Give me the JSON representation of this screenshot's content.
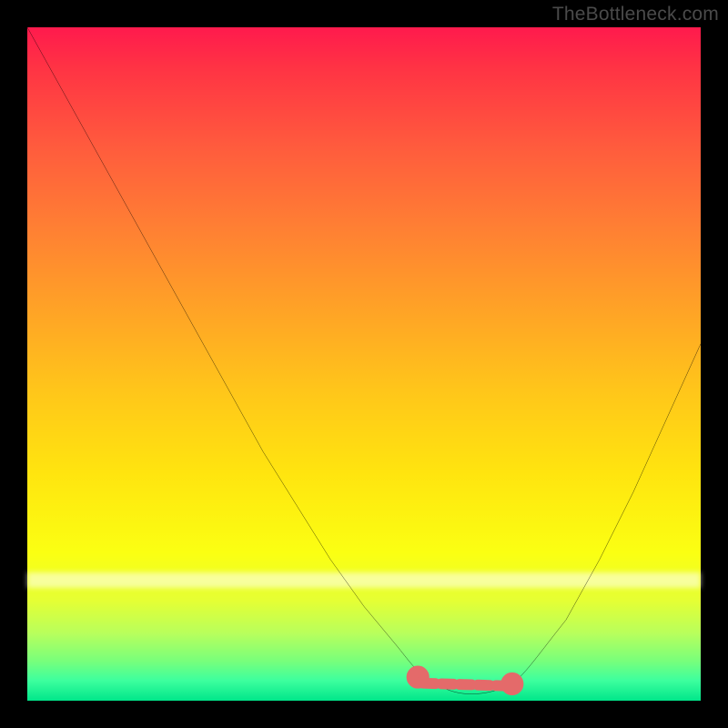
{
  "attribution": "TheBottleneck.com",
  "colors": {
    "background": "#000000",
    "gradient_top": "#ff1a4d",
    "gradient_bottom": "#00e68a",
    "curve": "#000000",
    "marker": "#e46a6a",
    "attribution_text": "#4a4a4a"
  },
  "chart_data": {
    "type": "line",
    "title": "",
    "xlabel": "",
    "ylabel": "",
    "xlim": [
      0,
      100
    ],
    "ylim": [
      0,
      100
    ],
    "grid": false,
    "legend": false,
    "x": [
      0,
      5,
      10,
      15,
      20,
      25,
      30,
      35,
      40,
      45,
      50,
      55,
      58,
      60,
      62,
      65,
      68,
      70,
      72,
      75,
      80,
      85,
      90,
      95,
      100
    ],
    "values": [
      100,
      91,
      82,
      73,
      64,
      55,
      46,
      37,
      29,
      21,
      14,
      8,
      5,
      3,
      2,
      1,
      1,
      1,
      2,
      5,
      12,
      21,
      31,
      42,
      53
    ],
    "annotations": [
      {
        "type": "flat_region_marker",
        "x_start": 58,
        "x_end": 72,
        "y": 1
      }
    ],
    "notes": "V-shaped bottleneck curve on a color gradient; minimum (optimal match) occurs around x≈65–68 where the curve is flat near y≈1. Color gradient encodes severity: red (top) = high bottleneck, green (bottom) = no bottleneck. No axis ticks or numeric labels rendered."
  }
}
